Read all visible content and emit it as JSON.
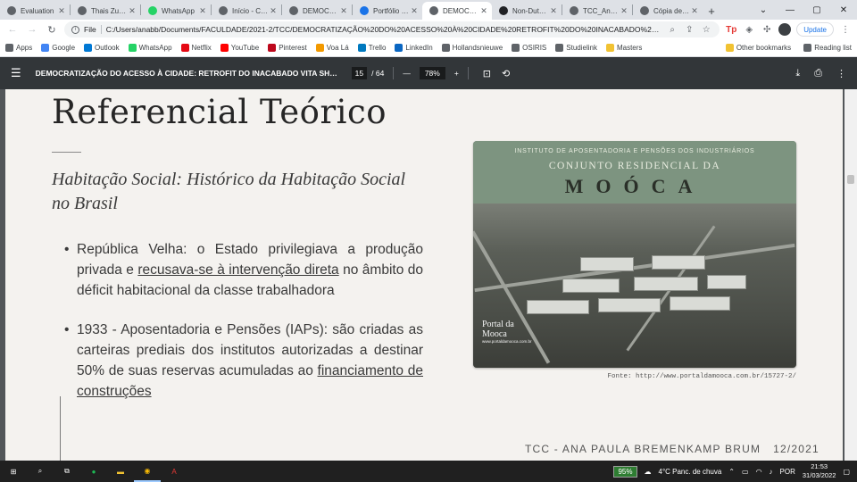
{
  "tabs": [
    {
      "title": "Evaluation",
      "color": "#5f6368",
      "icon": "globe-icon"
    },
    {
      "title": "Thais Zuch...",
      "color": "#5f6368",
      "icon": "globe-icon"
    },
    {
      "title": "WhatsApp",
      "color": "#25d366",
      "icon": "whatsapp-icon"
    },
    {
      "title": "Início - Canv...",
      "color": "#5f6368",
      "icon": "globe-icon"
    },
    {
      "title": "DEMOCRAT...",
      "color": "#5f6368",
      "icon": "globe-icon"
    },
    {
      "title": "Portfólio M...",
      "color": "#1a73e8",
      "icon": "globe-icon"
    },
    {
      "title": "DEMOCRAT...",
      "color": "#5f6368",
      "icon": "globe-icon",
      "active": true
    },
    {
      "title": "Non-Dutch...",
      "color": "#202124",
      "icon": "bird-icon"
    },
    {
      "title": "TCC_Ana P...",
      "color": "#5f6368",
      "icon": "globe-icon"
    },
    {
      "title": "Cópia de P...",
      "color": "#5f6368",
      "icon": "globe-icon"
    }
  ],
  "toolbar": {
    "scheme": "File",
    "url": "C:/Users/anabb/Documents/FACULDADE/2021-2/TCC/DEMOCRATIZAÇÃO%20DO%20ACESSO%20À%20CIDADE%20RETROFIT%20DO%20INACABADO%20VITA...",
    "update_label": "Update"
  },
  "bookmarks": [
    {
      "label": "Apps",
      "color": "#5f6368"
    },
    {
      "label": "Google",
      "color": "#4285f4"
    },
    {
      "label": "Outlook",
      "color": "#0078d4"
    },
    {
      "label": "WhatsApp",
      "color": "#25d366"
    },
    {
      "label": "Netflix",
      "color": "#e50914"
    },
    {
      "label": "YouTube",
      "color": "#ff0000"
    },
    {
      "label": "Pinterest",
      "color": "#bd081c"
    },
    {
      "label": "Voa Lá",
      "color": "#f29900"
    },
    {
      "label": "Trello",
      "color": "#0079bf"
    },
    {
      "label": "LinkedIn",
      "color": "#0a66c2"
    },
    {
      "label": "Hollandsnieuwe",
      "color": "#5f6368"
    },
    {
      "label": "OSIRIS",
      "color": "#5f6368"
    },
    {
      "label": "Studielink",
      "color": "#5f6368"
    },
    {
      "label": "Masters",
      "color": "#f1c232"
    }
  ],
  "bookmarks_right": {
    "other": "Other bookmarks",
    "reading": "Reading list"
  },
  "pdf": {
    "title": "DEMOCRATIZAÇÃO DO ACESSO À CIDADE: RETROFIT DO INACABADO VITA SHOPP...",
    "page_current": "15",
    "page_total": "/ 64",
    "zoom": "78%"
  },
  "slide": {
    "heading": "Referencial Teórico",
    "subtitle": "Habitação Social: Histórico da Habitação Social no Brasil",
    "bullet1_lead": "República Velha:  o Estado privilegiava a produção privada e ",
    "bullet1_u": "recusava-se à intervenção direta",
    "bullet1_tail": " no âmbito do déficit habitacional da classe trabalhadora",
    "bullet2_lead": "1933 - Aposentadoria e Pensões (IAPs): são criadas as carteiras prediais dos institutos autorizadas a destinar 50% de suas reservas acumuladas ao ",
    "bullet2_u": "financiamento de construções",
    "photo_inst": "INSTITUTO DE APOSENTADORIA E PENSÕES DOS INDUSTRIÁRIOS",
    "photo_conj": "CONJUNTO RESIDENCIAL DA",
    "photo_mooca": "MOÓCA",
    "photo_badge": "Portal da Mooca",
    "photo_badge_sub": "www.portaldamooca.com.br",
    "caption": "Fonte: http://www.portaldamooca.com.br/15727-2/",
    "footer_author": "TCC - ANA PAULA BREMENKAMP BRUM",
    "footer_date": "12/2021"
  },
  "taskbar": {
    "battery": "95%",
    "weather": "4°C  Panc. de chuva",
    "lang": "POR",
    "time": "21:53",
    "date": "31/03/2022"
  }
}
